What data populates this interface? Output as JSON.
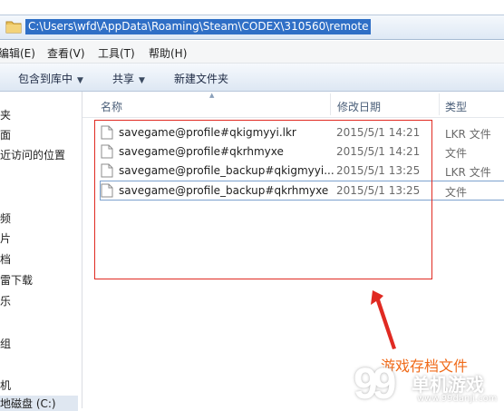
{
  "address_bar": {
    "path": "C:\\Users\\wfd\\AppData\\Roaming\\Steam\\CODEX\\310560\\remote"
  },
  "menubar": {
    "items": [
      "编辑(E)",
      "查看(V)",
      "工具(T)",
      "帮助(H)"
    ]
  },
  "toolbar": {
    "include_library": "包含到库中",
    "share": "共享",
    "new_folder": "新建文件夹"
  },
  "nav_pane": {
    "items": [
      "夹",
      "面",
      "近访问的位置",
      "频",
      "片",
      "档",
      "雷下载",
      "乐",
      "组",
      "机",
      "地磁盘 (C:)"
    ]
  },
  "columns": {
    "name": "名称",
    "date": "修改日期",
    "type": "类型"
  },
  "files": [
    {
      "name": "savegame@profile#qkigmyyi.lkr",
      "date": "2015/5/1 14:21",
      "type": "LKR 文件"
    },
    {
      "name": "savegame@profile#qkrhmyxe",
      "date": "2015/5/1 14:21",
      "type": "文件"
    },
    {
      "name": "savegame@profile_backup#qkigmyyi...",
      "date": "2015/5/1 13:25",
      "type": "LKR 文件"
    },
    {
      "name": "savegame@profile_backup#qkrhmyxe",
      "date": "2015/5/1 13:25",
      "type": "文件"
    }
  ],
  "annotation": {
    "label": "游戏存档文件",
    "color": "#e02a22"
  },
  "watermark": {
    "logo_text": "99",
    "site_name": "单机游戏",
    "url": "www.99danji.com"
  },
  "colors": {
    "selection": "#2f6fc6",
    "toolbar": "#dde7f3"
  }
}
